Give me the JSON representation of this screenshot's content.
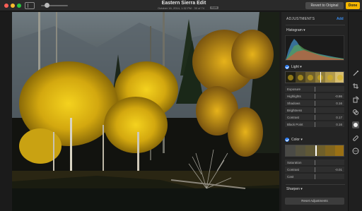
{
  "window": {
    "title": "Eastern Sierra Edit",
    "subtitle": "October 16, 2014, 1:32 PM  ·  30 of 74",
    "badge": "RAW",
    "revert_label": "Revert to Original",
    "done_label": "Done"
  },
  "panel": {
    "title": "ADJUSTMENTS",
    "add_label": "Add",
    "histogram_label": "Histogram",
    "light": {
      "label": "Light",
      "slider_position": 0.58,
      "rows": [
        {
          "label": "Exposure",
          "value": ""
        },
        {
          "label": "Highlights",
          "value": "-0.86"
        },
        {
          "label": "Shadows",
          "value": "0.16"
        },
        {
          "label": "Brightness",
          "value": ""
        },
        {
          "label": "Contrast",
          "value": "0.17"
        },
        {
          "label": "Black Point",
          "value": "0.16"
        }
      ]
    },
    "color": {
      "label": "Color",
      "slider_position": 0.5,
      "rows": [
        {
          "label": "Saturation",
          "value": ""
        },
        {
          "label": "Contrast",
          "value": "-0.01"
        },
        {
          "label": "Cast",
          "value": ""
        }
      ]
    },
    "sharpen_label": "Sharpen",
    "reset_label": "Reset Adjustments"
  },
  "tools": [
    {
      "icon": "retouch-icon"
    },
    {
      "icon": "crop-icon"
    },
    {
      "icon": "rotate-icon"
    },
    {
      "icon": "filters-icon"
    },
    {
      "icon": "adjust-icon",
      "active": true
    },
    {
      "icon": "bandage-icon"
    },
    {
      "icon": "more-icon"
    }
  ]
}
